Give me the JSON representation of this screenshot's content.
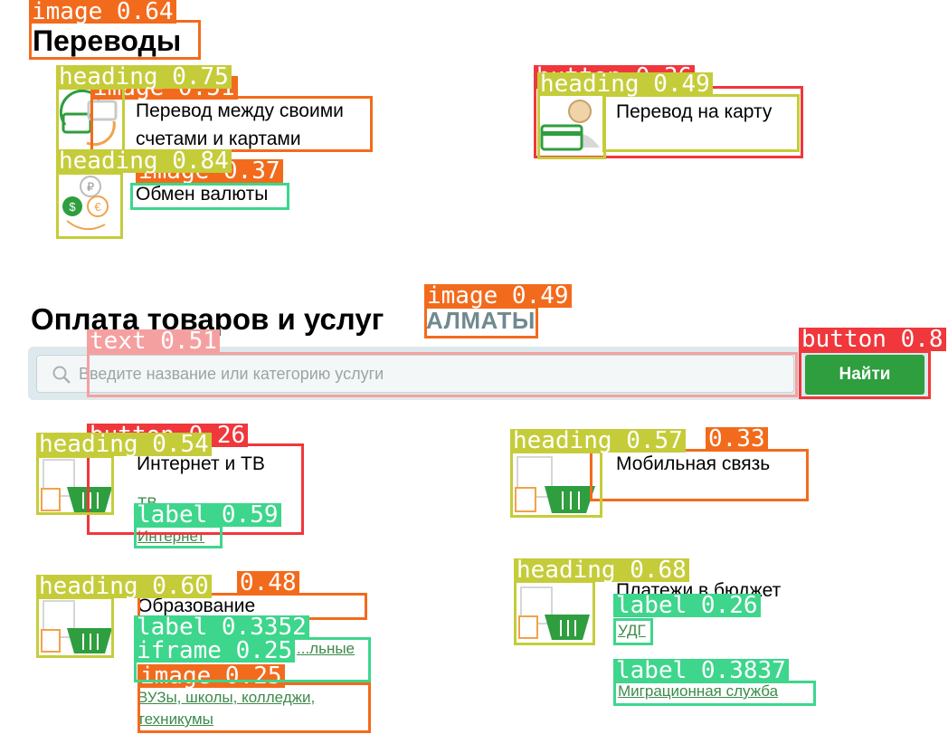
{
  "transfers": {
    "title": "Переводы",
    "items": [
      {
        "label_line1": "Перевод между своими",
        "label_line2": "счетами и картами"
      },
      {
        "label": "Перевод на карту"
      },
      {
        "label": "Обмен валюты"
      }
    ]
  },
  "payments": {
    "title": "Оплата товаров и услуг",
    "city": "АЛМАТЫ",
    "search": {
      "placeholder": "Введите название или категорию услуги",
      "button": "Найти"
    },
    "categories": [
      {
        "title": "Интернет и ТВ",
        "subs": [
          "ТВ",
          "Интернет"
        ]
      },
      {
        "title": "Мобильная связь",
        "subs": []
      },
      {
        "title": "Образование",
        "subs": [
          "...льные",
          "ВУЗы, школы, колледжи,",
          "техникумы"
        ]
      },
      {
        "title": "Платежи в бюджет",
        "subs": [
          "УДГ",
          "Миграционная служба"
        ]
      }
    ]
  },
  "overlay": {
    "labels": {
      "image_064": "image 0.64",
      "heading_075": "heading 0.75",
      "image_051": "image 0.51",
      "button_036": "button 0.36",
      "heading_049": "heading 0.49",
      "heading_084": "heading 0.84",
      "image_037": "image 0.37",
      "image_049": "image 0.49",
      "text_051": "text 0.51",
      "button_08": "button 0.8",
      "button_026": "button 0.26",
      "heading_054": "heading 0.54",
      "label_059": "label 0.59",
      "heading_057": "heading 0.57",
      "x_033": "0.33",
      "heading_060": "heading 0.60",
      "x_048": "0.48",
      "label_033": "label 0.3352",
      "iframe_025": "iframe 0.25",
      "image_025": "image 0.25",
      "heading_068": "heading 0.68",
      "label_026": "label 0.26",
      "label_038": "label 0.3837"
    },
    "colors": {
      "orange": "#f26b1d",
      "red": "#f0373c",
      "olive": "#c5cc3a",
      "green": "#3dd68c",
      "pink": "#f5a0a0"
    }
  }
}
